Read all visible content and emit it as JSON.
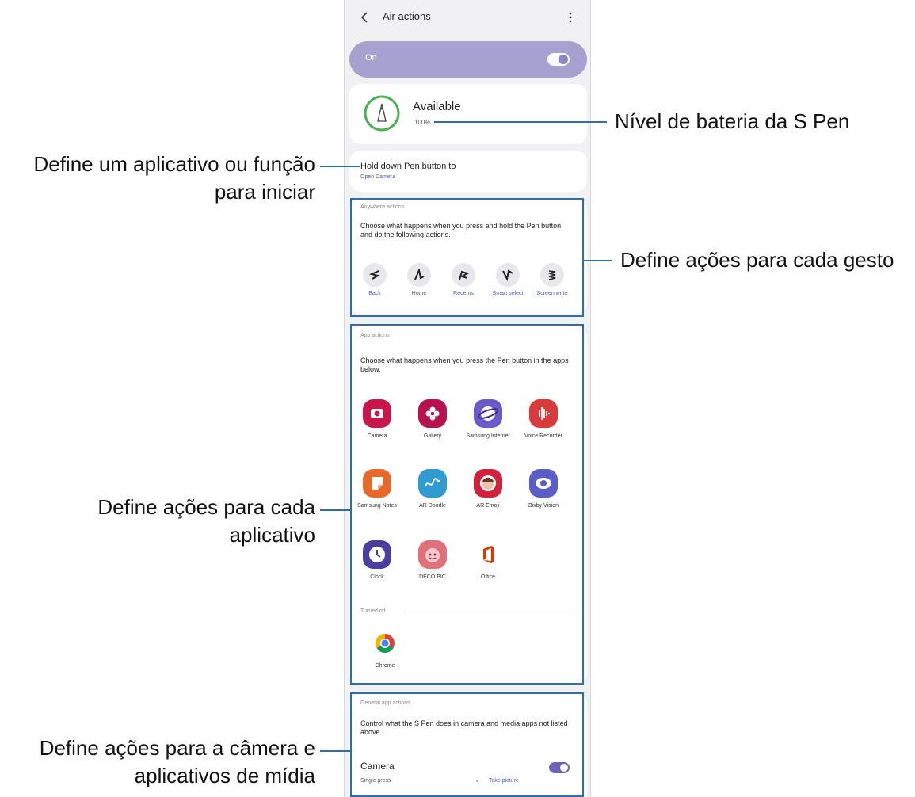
{
  "header": {
    "title": "Air actions"
  },
  "master_switch": {
    "label": "On",
    "state": "on"
  },
  "battery": {
    "status": "Available",
    "percent": "100%"
  },
  "hold_pen": {
    "title": "Hold down Pen button to",
    "value": "Open Camera"
  },
  "anywhere_actions": {
    "heading": "Anywhere actions",
    "description": "Choose what happens when you press and hold the Pen button and do the following actions.",
    "items": [
      {
        "label": "Back",
        "icon": "gesture-back-icon"
      },
      {
        "label": "Home",
        "icon": "gesture-home-icon"
      },
      {
        "label": "Recents",
        "icon": "gesture-recents-icon"
      },
      {
        "label": "Smart select",
        "icon": "gesture-smart-select-icon"
      },
      {
        "label": "Screen write",
        "icon": "gesture-screen-write-icon"
      }
    ]
  },
  "app_actions": {
    "heading": "App actions",
    "description": "Choose what happens when you press the Pen button in the apps below.",
    "apps": [
      {
        "label": "Camera",
        "color": "#c8174a",
        "icon": "camera-app-icon"
      },
      {
        "label": "Gallery",
        "color": "#b5124f",
        "icon": "gallery-app-icon"
      },
      {
        "label": "Samsung Internet",
        "color": "#6a5bc8",
        "icon": "samsung-internet-app-icon"
      },
      {
        "label": "Voice Recorder",
        "color": "#d83b3b",
        "icon": "voice-recorder-app-icon"
      },
      {
        "label": "Samsung Notes",
        "color": "#e86a2a",
        "icon": "samsung-notes-app-icon"
      },
      {
        "label": "AR Doodle",
        "color": "#2f9bd1",
        "icon": "ar-doodle-app-icon"
      },
      {
        "label": "AR Emoji",
        "color": "#d1213c",
        "icon": "ar-emoji-app-icon"
      },
      {
        "label": "Bixby Vision",
        "color": "#5b5ec7",
        "icon": "bixby-vision-app-icon"
      },
      {
        "label": "Clock",
        "color": "#4a3f9e",
        "icon": "clock-app-icon"
      },
      {
        "label": "DECO PIC",
        "color": "#e0707a",
        "icon": "deco-pic-app-icon"
      },
      {
        "label": "Office",
        "color": "#d83b01",
        "icon": "office-app-icon"
      }
    ],
    "turned_off_heading": "Turned off",
    "turned_off_apps": [
      {
        "label": "Chrome",
        "icon": "chrome-app-icon"
      }
    ]
  },
  "general_app_actions": {
    "heading": "General app actions",
    "description": "Control what the S Pen does in camera and media apps not listed above.",
    "camera_label": "Camera",
    "single_press_label": "Single press",
    "single_press_value": "Take picture"
  },
  "callouts": {
    "battery": "Nível de bateria da S Pen",
    "hold_line1": "Define um aplicativo ou função",
    "hold_line2": "para iniciar",
    "gestures": "Define ações para cada gesto",
    "apps_line1": "Define ações para cada",
    "apps_line2": "aplicativo",
    "media_line1": "Define ações para a câmera e",
    "media_line2": "aplicativos de mídia"
  },
  "colors": {
    "accent": "#4b59c9",
    "highlight": "#2f6fa5",
    "switch_bar": "#a7a1cf",
    "battery_ring": "#4caf50"
  }
}
